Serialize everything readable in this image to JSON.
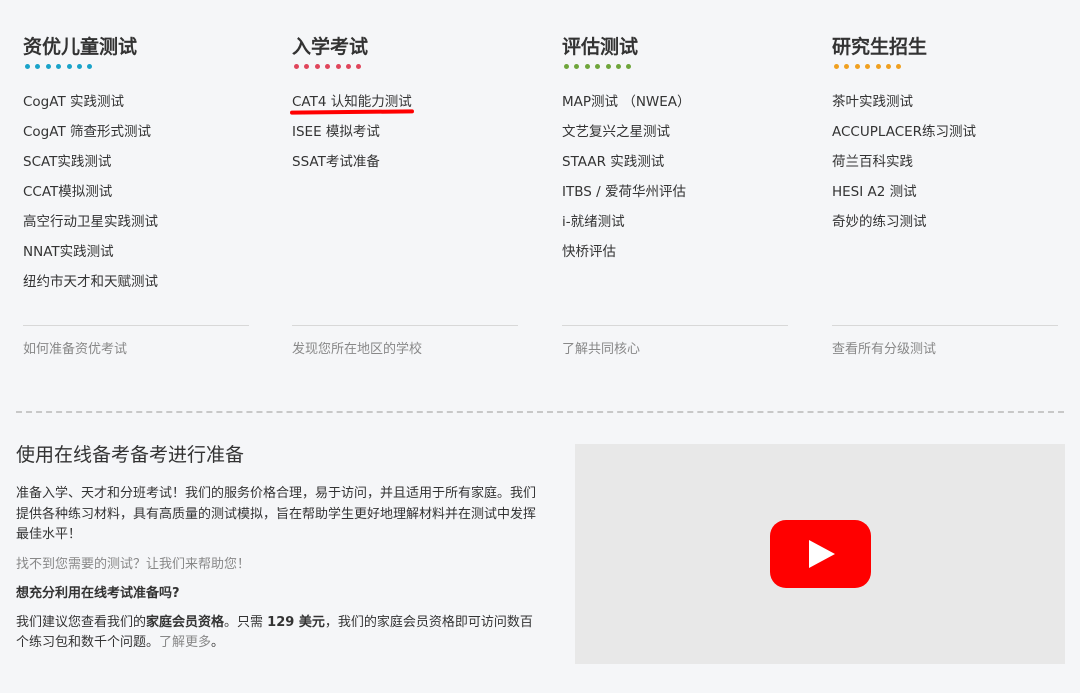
{
  "columns": [
    {
      "title": "资优儿童测试",
      "dot_color": "#1aa3c9",
      "links": [
        "CogAT 实践测试",
        "CogAT 筛查形式测试",
        "SCAT实践测试",
        "CCAT模拟测试",
        "高空行动卫星实践测试",
        "NNAT实践测试",
        "纽约市天才和天赋测试"
      ],
      "footer": "如何准备资优考试"
    },
    {
      "title": "入学考试",
      "dot_color": "#e0455b",
      "links": [
        "CAT4 认知能力测试",
        "ISEE 模拟考试",
        "SSAT考试准备"
      ],
      "footer": "发现您所在地区的学校"
    },
    {
      "title": "评估测试",
      "dot_color": "#6fa53b",
      "links": [
        "MAP测试 （NWEA）",
        "文艺复兴之星测试",
        "STAAR 实践测试",
        "ITBS / 爱荷华州评估",
        "i-就绪测试",
        "快桥评估"
      ],
      "footer": "了解共同核心"
    },
    {
      "title": "研究生招生",
      "dot_color": "#f0a020",
      "links": [
        "茶叶实践测试",
        "ACCUPLACER练习测试",
        "荷兰百科实践",
        "HESI A2 测试",
        "奇妙的练习测试"
      ],
      "footer": "查看所有分级测试"
    }
  ],
  "promo": {
    "heading": "使用在线备考备考进行准备",
    "body": "准备入学、天才和分班考试！我们的服务价格合理，易于访问，并且适用于所有家庭。我们提供各种练习材料，具有高质量的测试模拟，旨在帮助学生更好地理解材料并在测试中发挥最佳水平！",
    "help_link": "找不到您需要的测试？让我们来帮助您！",
    "question": "想充分利用在线考试准备吗?",
    "reco_1": "我们建议您查看我们的",
    "reco_bold_1": "家庭会员资格",
    "reco_2": "。只需 ",
    "reco_bold_2": "129 美元",
    "reco_3": "，我们的家庭会员资格即可访问数百个练习包和数千个问题。",
    "learn_more": "了解更多",
    "reco_end": "。"
  },
  "video": {
    "play_icon": "youtube-play-icon",
    "brand_color": "#ff0000"
  }
}
